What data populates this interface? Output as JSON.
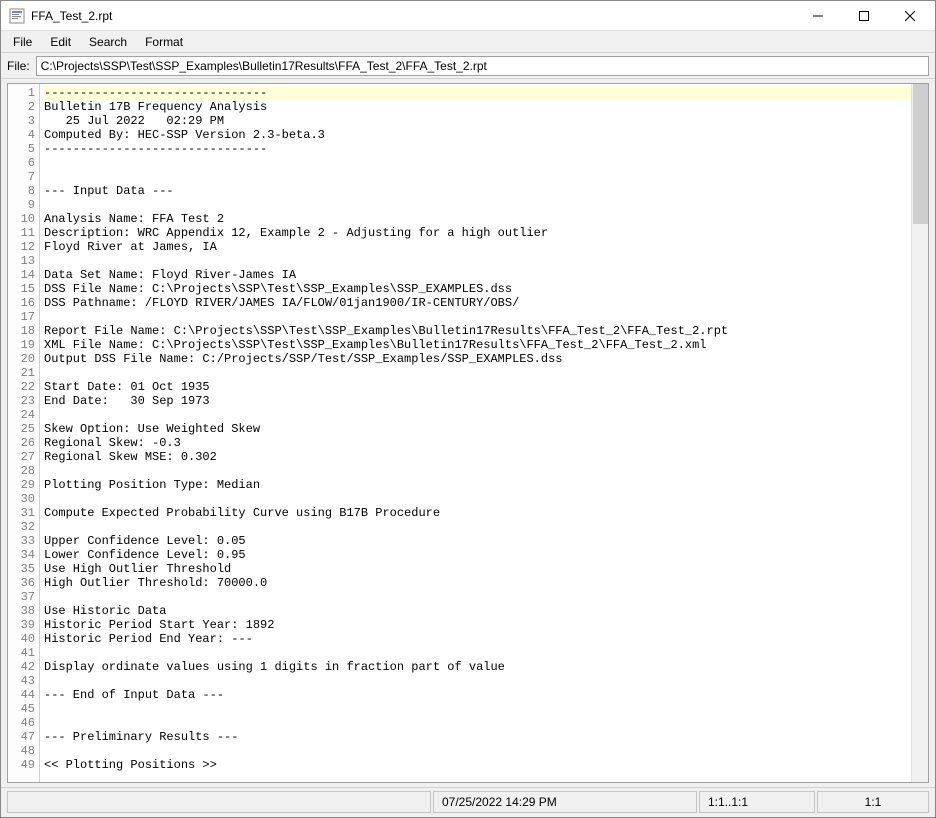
{
  "window": {
    "title": "FFA_Test_2.rpt"
  },
  "menu": {
    "file": "File",
    "edit": "Edit",
    "search": "Search",
    "format": "Format"
  },
  "file": {
    "label": "File:",
    "path": "C:\\Projects\\SSP\\Test\\SSP_Examples\\Bulletin17Results\\FFA_Test_2\\FFA_Test_2.rpt"
  },
  "statusbar": {
    "datetime": "07/25/2022 14:29 PM",
    "pos1": "1:1..1:1",
    "pos2": "1:1"
  },
  "lines": [
    "-------------------------------",
    "Bulletin 17B Frequency Analysis",
    "   25 Jul 2022   02:29 PM",
    "Computed By: HEC-SSP Version 2.3-beta.3",
    "-------------------------------",
    "",
    "",
    "--- Input Data ---",
    "",
    "Analysis Name: FFA Test 2",
    "Description: WRC Appendix 12, Example 2 - Adjusting for a high outlier",
    "Floyd River at James, IA",
    "",
    "Data Set Name: Floyd River-James IA",
    "DSS File Name: C:\\Projects\\SSP\\Test\\SSP_Examples\\SSP_EXAMPLES.dss",
    "DSS Pathname: /FLOYD RIVER/JAMES IA/FLOW/01jan1900/IR-CENTURY/OBS/",
    "",
    "Report File Name: C:\\Projects\\SSP\\Test\\SSP_Examples\\Bulletin17Results\\FFA_Test_2\\FFA_Test_2.rpt",
    "XML File Name: C:\\Projects\\SSP\\Test\\SSP_Examples\\Bulletin17Results\\FFA_Test_2\\FFA_Test_2.xml",
    "Output DSS File Name: C:/Projects/SSP/Test/SSP_Examples/SSP_EXAMPLES.dss",
    "",
    "Start Date: 01 Oct 1935",
    "End Date:   30 Sep 1973",
    "",
    "Skew Option: Use Weighted Skew",
    "Regional Skew: -0.3",
    "Regional Skew MSE: 0.302",
    "",
    "Plotting Position Type: Median",
    "",
    "Compute Expected Probability Curve using B17B Procedure",
    "",
    "Upper Confidence Level: 0.05",
    "Lower Confidence Level: 0.95",
    "Use High Outlier Threshold",
    "High Outlier Threshold: 70000.0",
    "",
    "Use Historic Data",
    "Historic Period Start Year: 1892",
    "Historic Period End Year: ---",
    "",
    "Display ordinate values using 1 digits in fraction part of value",
    "",
    "--- End of Input Data ---",
    "",
    "",
    "--- Preliminary Results ---",
    "",
    "<< Plotting Positions >>"
  ]
}
